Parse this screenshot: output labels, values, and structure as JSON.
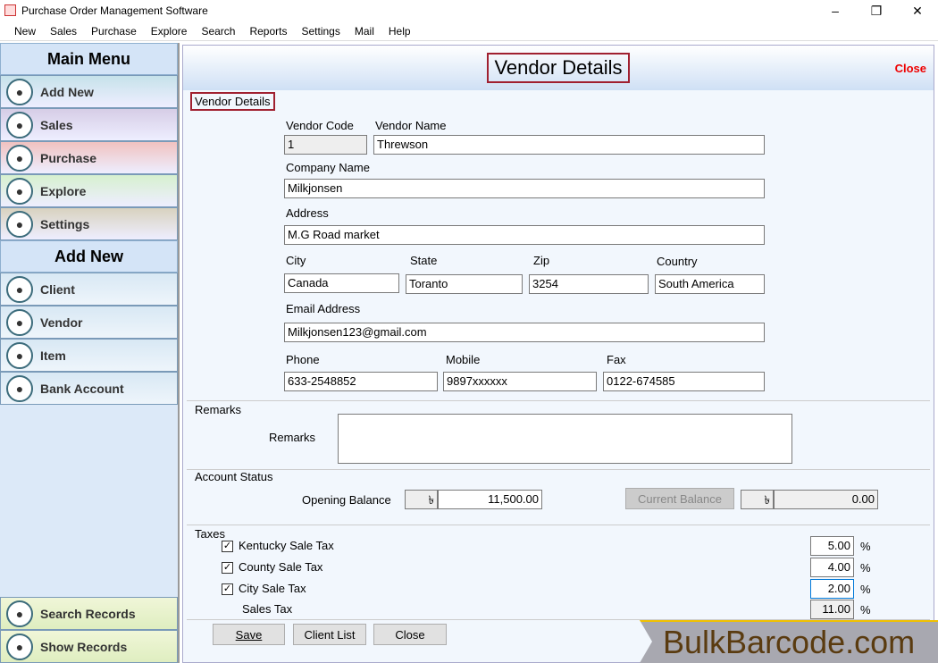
{
  "window": {
    "title": "Purchase Order Management Software",
    "minimize": "–",
    "maximize": "❐",
    "close": "✕"
  },
  "menu": [
    "New",
    "Sales",
    "Purchase",
    "Explore",
    "Search",
    "Reports",
    "Settings",
    "Mail",
    "Help"
  ],
  "sidebar": {
    "main_header": "Main Menu",
    "main_items": [
      {
        "label": "Add New",
        "icon": "document-add-icon",
        "bg": "#c6e2ea"
      },
      {
        "label": "Sales",
        "icon": "bar-chart-icon",
        "bg": "#d6cde6"
      },
      {
        "label": "Purchase",
        "icon": "basket-icon",
        "bg": "#f0c2c0"
      },
      {
        "label": "Explore",
        "icon": "magnifier-icon",
        "bg": "#d6f0cf"
      },
      {
        "label": "Settings",
        "icon": "gear-icon",
        "bg": "#d8d2bf"
      }
    ],
    "add_header": "Add New",
    "add_items": [
      {
        "label": "Client",
        "icon": "client-icon"
      },
      {
        "label": "Vendor",
        "icon": "vendor-icon"
      },
      {
        "label": "Item",
        "icon": "shopping-bag-icon"
      },
      {
        "label": "Bank Account",
        "icon": "bank-icon"
      }
    ],
    "bottom_items": [
      {
        "label": "Search Records",
        "icon": "search-records-icon"
      },
      {
        "label": "Show Records",
        "icon": "show-records-icon"
      }
    ]
  },
  "form": {
    "title": "Vendor Details",
    "close": "Close",
    "section": "Vendor Details",
    "vendor_code_label": "Vendor Code",
    "vendor_code": "1",
    "vendor_name_label": "Vendor Name",
    "vendor_name": "Threwson",
    "company_label": "Company Name",
    "company": "Milkjonsen",
    "address_label": "Address",
    "address": "M.G Road market",
    "city_label": "City",
    "city": "Canada",
    "state_label": "State",
    "state": "Toranto",
    "zip_label": "Zip",
    "zip": "3254",
    "country_label": "Country",
    "country": "South America",
    "email_label": "Email Address",
    "email": "Milkjonsen123@gmail.com",
    "phone_label": "Phone",
    "phone": "633-2548852",
    "mobile_label": "Mobile",
    "mobile": "9897xxxxxx",
    "fax_label": "Fax",
    "fax": "0122-674585",
    "remarks_group": "Remarks",
    "remarks_label": "Remarks",
    "remarks": "",
    "account_group": "Account Status",
    "opening_label": "Opening Balance",
    "currency": "৳",
    "opening": "11,500.00",
    "current_button": "Current Balance",
    "current": "0.00",
    "taxes_group": "Taxes",
    "taxes": [
      {
        "label": "Kentucky Sale Tax",
        "value": "5.00",
        "checked": true
      },
      {
        "label": "County Sale Tax",
        "value": "4.00",
        "checked": true
      },
      {
        "label": "City Sale Tax",
        "value": "2.00",
        "checked": true
      }
    ],
    "sales_tax_label": "Sales Tax",
    "sales_tax": "11.00",
    "percent": "%",
    "save": "Save",
    "client_list": "Client List",
    "close_button": "Close"
  },
  "watermark": "BulkBarcode.com"
}
